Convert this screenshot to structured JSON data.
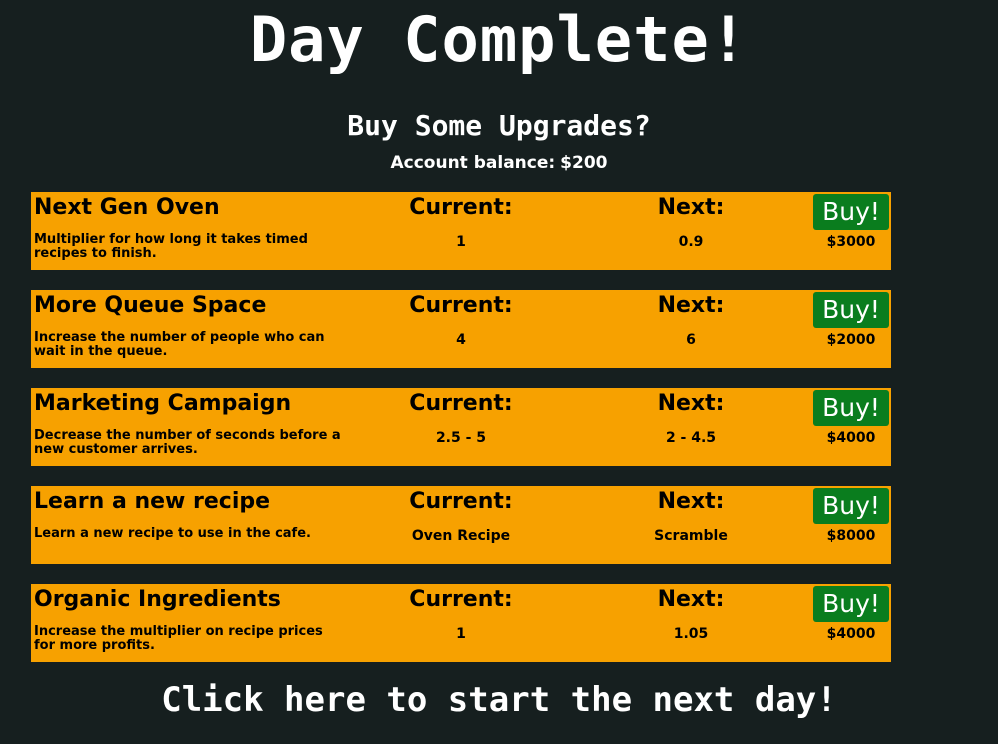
{
  "title": "Day Complete!",
  "subtitle": "Buy Some Upgrades?",
  "account": {
    "label": "Account balance:",
    "value": "$200"
  },
  "columns": {
    "current_label": "Current:",
    "next_label": "Next:",
    "buy_label": "Buy!"
  },
  "upgrades": [
    {
      "name": "Next Gen Oven",
      "description": "Multiplier for how long it takes timed recipes to finish.",
      "current": "1",
      "next": "0.9",
      "price": "$3000"
    },
    {
      "name": "More Queue Space",
      "description": "Increase the number of people who can wait in the queue.",
      "current": "4",
      "next": "6",
      "price": "$2000"
    },
    {
      "name": "Marketing Campaign",
      "description": "Decrease the number of seconds before a new customer arrives.",
      "current": "2.5 - 5",
      "next": "2 - 4.5",
      "price": "$4000"
    },
    {
      "name": "Learn a new recipe",
      "description": "Learn a new recipe to use in the cafe.",
      "current": "Oven Recipe",
      "next": "Scramble",
      "price": "$8000"
    },
    {
      "name": "Organic Ingredients",
      "description": "Increase the multiplier on recipe prices for more profits.",
      "current": "1",
      "next": "1.05",
      "price": "$4000"
    }
  ],
  "footer": {
    "start_label": "Click here to start the next day!"
  },
  "colors": {
    "background": "#161f1f",
    "row_background": "#f7a100",
    "buy_button": "#0a7d1e",
    "text_primary": "#ffffff",
    "row_text": "#000000"
  }
}
